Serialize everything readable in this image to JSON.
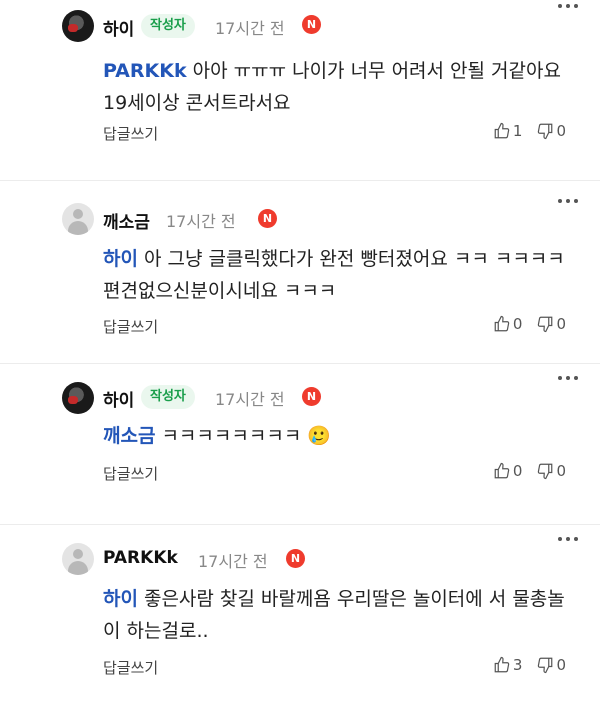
{
  "comments": [
    {
      "author": "하이",
      "badge": "작성자",
      "time": "17시간 전",
      "new_badge": "N",
      "mention": "PARKKk",
      "text": "아아 ㅠㅠㅠ 나이가 너무 어려서 안될 거같아요 19세이상 콘서트라서요",
      "reply_label": "답글쓰기",
      "likes": "1",
      "dislikes": "0"
    },
    {
      "author": "깨소금",
      "badge": "",
      "time": "17시간 전",
      "new_badge": "N",
      "mention": "하이",
      "text": "아 그냥 글클릭했다가 완전 빵터졌어요 ㅋㅋ ㅋㅋㅋㅋ 편견없으신분이시네요 ㅋㅋㅋ",
      "reply_label": "답글쓰기",
      "likes": "0",
      "dislikes": "0"
    },
    {
      "author": "하이",
      "badge": "작성자",
      "time": "17시간 전",
      "new_badge": "N",
      "mention": "깨소금",
      "text": "ㅋㅋㅋㅋㅋㅋㅋㅋ 🥲",
      "reply_label": "답글쓰기",
      "likes": "0",
      "dislikes": "0"
    },
    {
      "author": "PARKKk",
      "badge": "",
      "time": "17시간 전",
      "new_badge": "N",
      "mention": "하이",
      "text": "좋은사람 찾길 바랄께욤 우리딸은 놀이터에 서 물총놀이 하는걸로..",
      "reply_label": "답글쓰기",
      "likes": "3",
      "dislikes": "0"
    }
  ],
  "icons": {
    "more": "more-vertical-icon",
    "like": "thumbs-up-icon",
    "dislike": "thumbs-down-icon"
  },
  "colors": {
    "mention": "#2356b8",
    "badge_text": "#1a9e4b",
    "badge_bg": "#eaf7ee",
    "new_badge": "#ef3b2d"
  }
}
